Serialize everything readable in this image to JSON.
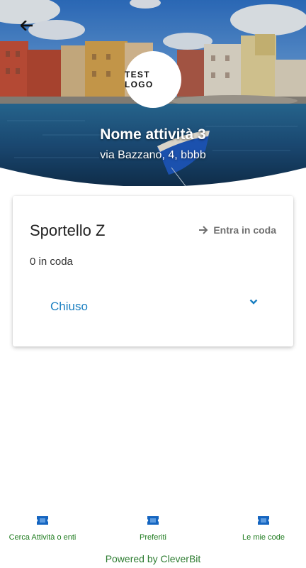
{
  "hero": {
    "back_icon": "arrow-left-icon",
    "logo_text": "TEST LOGO",
    "business_name": "Nome attività 3",
    "address": "via Bazzano, 4, bbbb"
  },
  "card": {
    "title": "Sportello Z",
    "join_label": "Entra in coda",
    "join_icon": "arrow-right-icon",
    "queue_count": "0 in coda",
    "status": "Chiuso",
    "status_icon": "chevron-down-icon"
  },
  "nav": {
    "items": [
      {
        "label": "Cerca Attività o enti",
        "icon": "ticket-icon"
      },
      {
        "label": "Preferiti",
        "icon": "ticket-icon"
      },
      {
        "label": "Le mie code",
        "icon": "ticket-icon"
      }
    ]
  },
  "footer": {
    "powered_by": "Powered by CleverBit"
  },
  "colors": {
    "accent_blue": "#1a7fc1",
    "nav_green": "#1e7b1e",
    "icon_blue": "#1565c0"
  }
}
